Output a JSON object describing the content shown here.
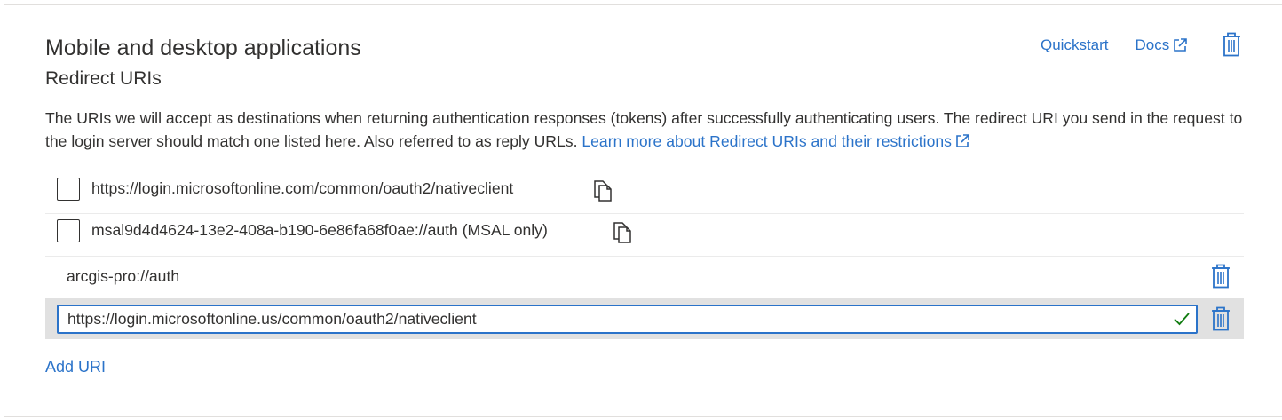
{
  "section": {
    "title": "Mobile and desktop applications",
    "subtitle": "Redirect URIs",
    "description": "The URIs we will accept as destinations when returning authentication responses (tokens) after successfully authenticating users. The redirect URI you send in the request to the login server should match one listed here. Also referred to as reply URLs.",
    "learn_more_label": "Learn more about Redirect URIs and their restrictions"
  },
  "header_links": {
    "quickstart_label": "Quickstart",
    "docs_label": "Docs"
  },
  "suggested_uris": [
    {
      "label": "https://login.microsoftonline.com/common/oauth2/nativeclient",
      "checked": false
    },
    {
      "label": "msal9d4d4624-13e2-408a-b190-6e86fa68f0ae://auth (MSAL only)",
      "checked": false
    }
  ],
  "custom_uris": [
    {
      "value": "arcgis-pro://auth"
    }
  ],
  "editing_uri": {
    "value": "https://login.microsoftonline.us/common/oauth2/nativeclient",
    "valid": true
  },
  "add_uri_label": "Add URI",
  "icons": {
    "external_link": "external-link-icon",
    "delete": "trash-icon",
    "copy": "copy-icon",
    "valid": "checkmark-icon"
  },
  "colors": {
    "accent": "#2b73c9",
    "text": "#323130",
    "valid": "#107c10",
    "editing_row_bg": "#e1e1e1"
  }
}
